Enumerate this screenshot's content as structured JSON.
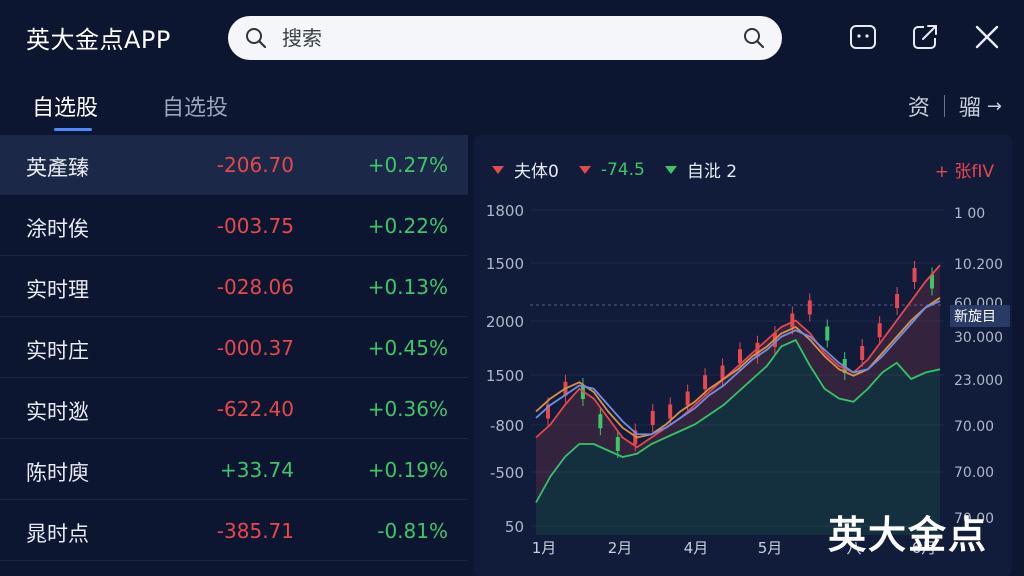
{
  "header": {
    "app_title": "英大金点APP",
    "search_placeholder": "搜索"
  },
  "tabs": [
    {
      "label": "自选股",
      "active": true
    },
    {
      "label": "自选投",
      "active": false
    }
  ],
  "right_links": {
    "first": "资",
    "second": "骝",
    "arrow": "→"
  },
  "list": [
    {
      "name": "英產臻",
      "value": "-206.70",
      "change": "+0.27%",
      "value_color": "red",
      "change_color": "green"
    },
    {
      "name": "涂时俟",
      "value": "-003.75",
      "change": "+0.22%",
      "value_color": "red",
      "change_color": "green"
    },
    {
      "name": "实时理",
      "value": "-028.06",
      "change": "+0.13%",
      "value_color": "red",
      "change_color": "green"
    },
    {
      "name": "实时庄",
      "value": "-000.37",
      "change": "+0.45%",
      "value_color": "red",
      "change_color": "green"
    },
    {
      "name": "实时逖",
      "value": "-622.40",
      "change": "+0.36%",
      "value_color": "red",
      "change_color": "green"
    },
    {
      "name": "陈时庾",
      "value": "+33.74",
      "change": "+0.19%",
      "value_color": "green",
      "change_color": "green"
    },
    {
      "name": "晁时点",
      "value": "-385.71",
      "change": "-0.81%",
      "value_color": "red",
      "change_color": "green"
    }
  ],
  "chart_legend": [
    {
      "label": "夫体0",
      "marker": "red"
    },
    {
      "label": "-74.5",
      "marker": "red"
    },
    {
      "label": "自沘 2",
      "marker": "green"
    }
  ],
  "chart_legend_right": "+ 张fIV",
  "chart_data": {
    "type": "line",
    "left_ticks": [
      "1800",
      "1500",
      "2000",
      "1500",
      "-800",
      "-500",
      "50"
    ],
    "right_ticks": [
      "1 00",
      "10.200",
      "60.000",
      "30.000",
      "23.000",
      "70.00",
      "70.00",
      "70.00"
    ],
    "x_ticks": [
      "1月",
      "2月",
      "4月",
      "5月",
      "八",
      "6月"
    ],
    "last_label": "新旋目",
    "series": [
      {
        "color": "#e5484d",
        "values": [
          0.3,
          0.34,
          0.4,
          0.45,
          0.42,
          0.36,
          0.3,
          0.27,
          0.3,
          0.33,
          0.36,
          0.4,
          0.44,
          0.48,
          0.52,
          0.56,
          0.6,
          0.64,
          0.66,
          0.62,
          0.56,
          0.52,
          0.5,
          0.54,
          0.6,
          0.66,
          0.72,
          0.78,
          0.83
        ]
      },
      {
        "color": "#d9904a",
        "values": [
          0.38,
          0.42,
          0.45,
          0.47,
          0.44,
          0.38,
          0.33,
          0.3,
          0.31,
          0.34,
          0.38,
          0.41,
          0.45,
          0.48,
          0.51,
          0.55,
          0.58,
          0.62,
          0.64,
          0.6,
          0.55,
          0.51,
          0.49,
          0.51,
          0.56,
          0.61,
          0.66,
          0.7,
          0.73
        ]
      },
      {
        "color": "#6f8fe0",
        "values": [
          0.36,
          0.4,
          0.43,
          0.46,
          0.45,
          0.4,
          0.35,
          0.31,
          0.31,
          0.33,
          0.36,
          0.39,
          0.43,
          0.46,
          0.5,
          0.54,
          0.57,
          0.61,
          0.63,
          0.61,
          0.57,
          0.53,
          0.5,
          0.51,
          0.55,
          0.6,
          0.65,
          0.7,
          0.72
        ]
      },
      {
        "color": "#35c36a",
        "values": [
          0.1,
          0.18,
          0.24,
          0.28,
          0.28,
          0.26,
          0.24,
          0.25,
          0.28,
          0.3,
          0.32,
          0.34,
          0.37,
          0.4,
          0.44,
          0.48,
          0.52,
          0.58,
          0.6,
          0.52,
          0.45,
          0.42,
          0.41,
          0.45,
          0.5,
          0.53,
          0.48,
          0.5,
          0.51
        ]
      }
    ],
    "candles": [
      0.38,
      0.45,
      0.44,
      0.35,
      0.28,
      0.3,
      0.36,
      0.38,
      0.42,
      0.47,
      0.5,
      0.55,
      0.57,
      0.6,
      0.66,
      0.7,
      0.62,
      0.52,
      0.56,
      0.63,
      0.72,
      0.8,
      0.78
    ]
  },
  "watermark": "英大金点"
}
